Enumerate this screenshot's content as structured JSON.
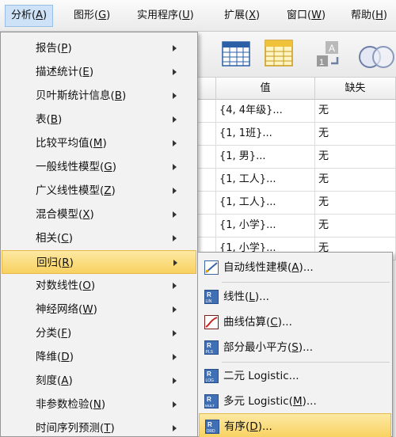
{
  "menubar": {
    "items": [
      {
        "text": "分析",
        "mnemonic": "A"
      },
      {
        "text": "图形",
        "mnemonic": "G"
      },
      {
        "text": "实用程序",
        "mnemonic": "U"
      },
      {
        "text": "扩展",
        "mnemonic": "X"
      },
      {
        "text": "窗口",
        "mnemonic": "W"
      },
      {
        "text": "帮助",
        "mnemonic": "H"
      }
    ]
  },
  "table": {
    "headers": {
      "value": "值",
      "missing": "缺失"
    },
    "rows": [
      {
        "value": "{4, 4年级}...",
        "missing": "无"
      },
      {
        "value": "{1, 1班}...",
        "missing": "无"
      },
      {
        "value": "{1, 男}...",
        "missing": "无"
      },
      {
        "value": "{1, 工人}...",
        "missing": "无"
      },
      {
        "value": "{1, 工人}...",
        "missing": "无"
      },
      {
        "value": "{1, 小学}...",
        "missing": "无"
      },
      {
        "value": "{1, 小学}...",
        "missing": "无"
      }
    ]
  },
  "analyze_menu": {
    "items": [
      {
        "text": "报告",
        "mnemonic": "P"
      },
      {
        "text": "描述统计",
        "mnemonic": "E"
      },
      {
        "text": "贝叶斯统计信息",
        "mnemonic": "B"
      },
      {
        "text": "表",
        "mnemonic": "B"
      },
      {
        "text": "比较平均值",
        "mnemonic": "M"
      },
      {
        "text": "一般线性模型",
        "mnemonic": "G"
      },
      {
        "text": "广义线性模型",
        "mnemonic": "Z"
      },
      {
        "text": "混合模型",
        "mnemonic": "X"
      },
      {
        "text": "相关",
        "mnemonic": "C"
      },
      {
        "text": "回归",
        "mnemonic": "R"
      },
      {
        "text": "对数线性",
        "mnemonic": "O"
      },
      {
        "text": "神经网络",
        "mnemonic": "W"
      },
      {
        "text": "分类",
        "mnemonic": "F"
      },
      {
        "text": "降维",
        "mnemonic": "D"
      },
      {
        "text": "刻度",
        "mnemonic": "A"
      },
      {
        "text": "非参数检验",
        "mnemonic": "N"
      },
      {
        "text": "时间序列预测",
        "mnemonic": "T"
      }
    ]
  },
  "regression_submenu": {
    "items": [
      {
        "text": "自动线性建模",
        "mnemonic": "A",
        "suffix": "...",
        "icon": "auto-linear-icon"
      },
      {
        "text": "线性",
        "mnemonic": "L",
        "suffix": "...",
        "icon": "linear-icon",
        "badge": "LIN"
      },
      {
        "text": "曲线估算",
        "mnemonic": "C",
        "suffix": "...",
        "icon": "curve-estimation-icon"
      },
      {
        "text": "部分最小平方",
        "mnemonic": "S",
        "suffix": "...",
        "icon": "partial-least-squares-icon",
        "badge": "PLS"
      },
      {
        "text": "二元 Logistic...",
        "mnemonic": "",
        "suffix": "",
        "icon": "binary-logistic-icon",
        "badge": "LOG"
      },
      {
        "text": "多元 Logistic",
        "mnemonic": "M",
        "suffix": "...",
        "icon": "multinomial-logistic-icon",
        "badge": "MULT"
      },
      {
        "text": "有序",
        "mnemonic": "D",
        "suffix": "...",
        "icon": "ordinal-icon",
        "badge": "ORD"
      }
    ]
  },
  "colors": {
    "highlight": "#f8d160",
    "menu_bg": "#f2f2f2",
    "active_menubar": "#cde1f7"
  }
}
